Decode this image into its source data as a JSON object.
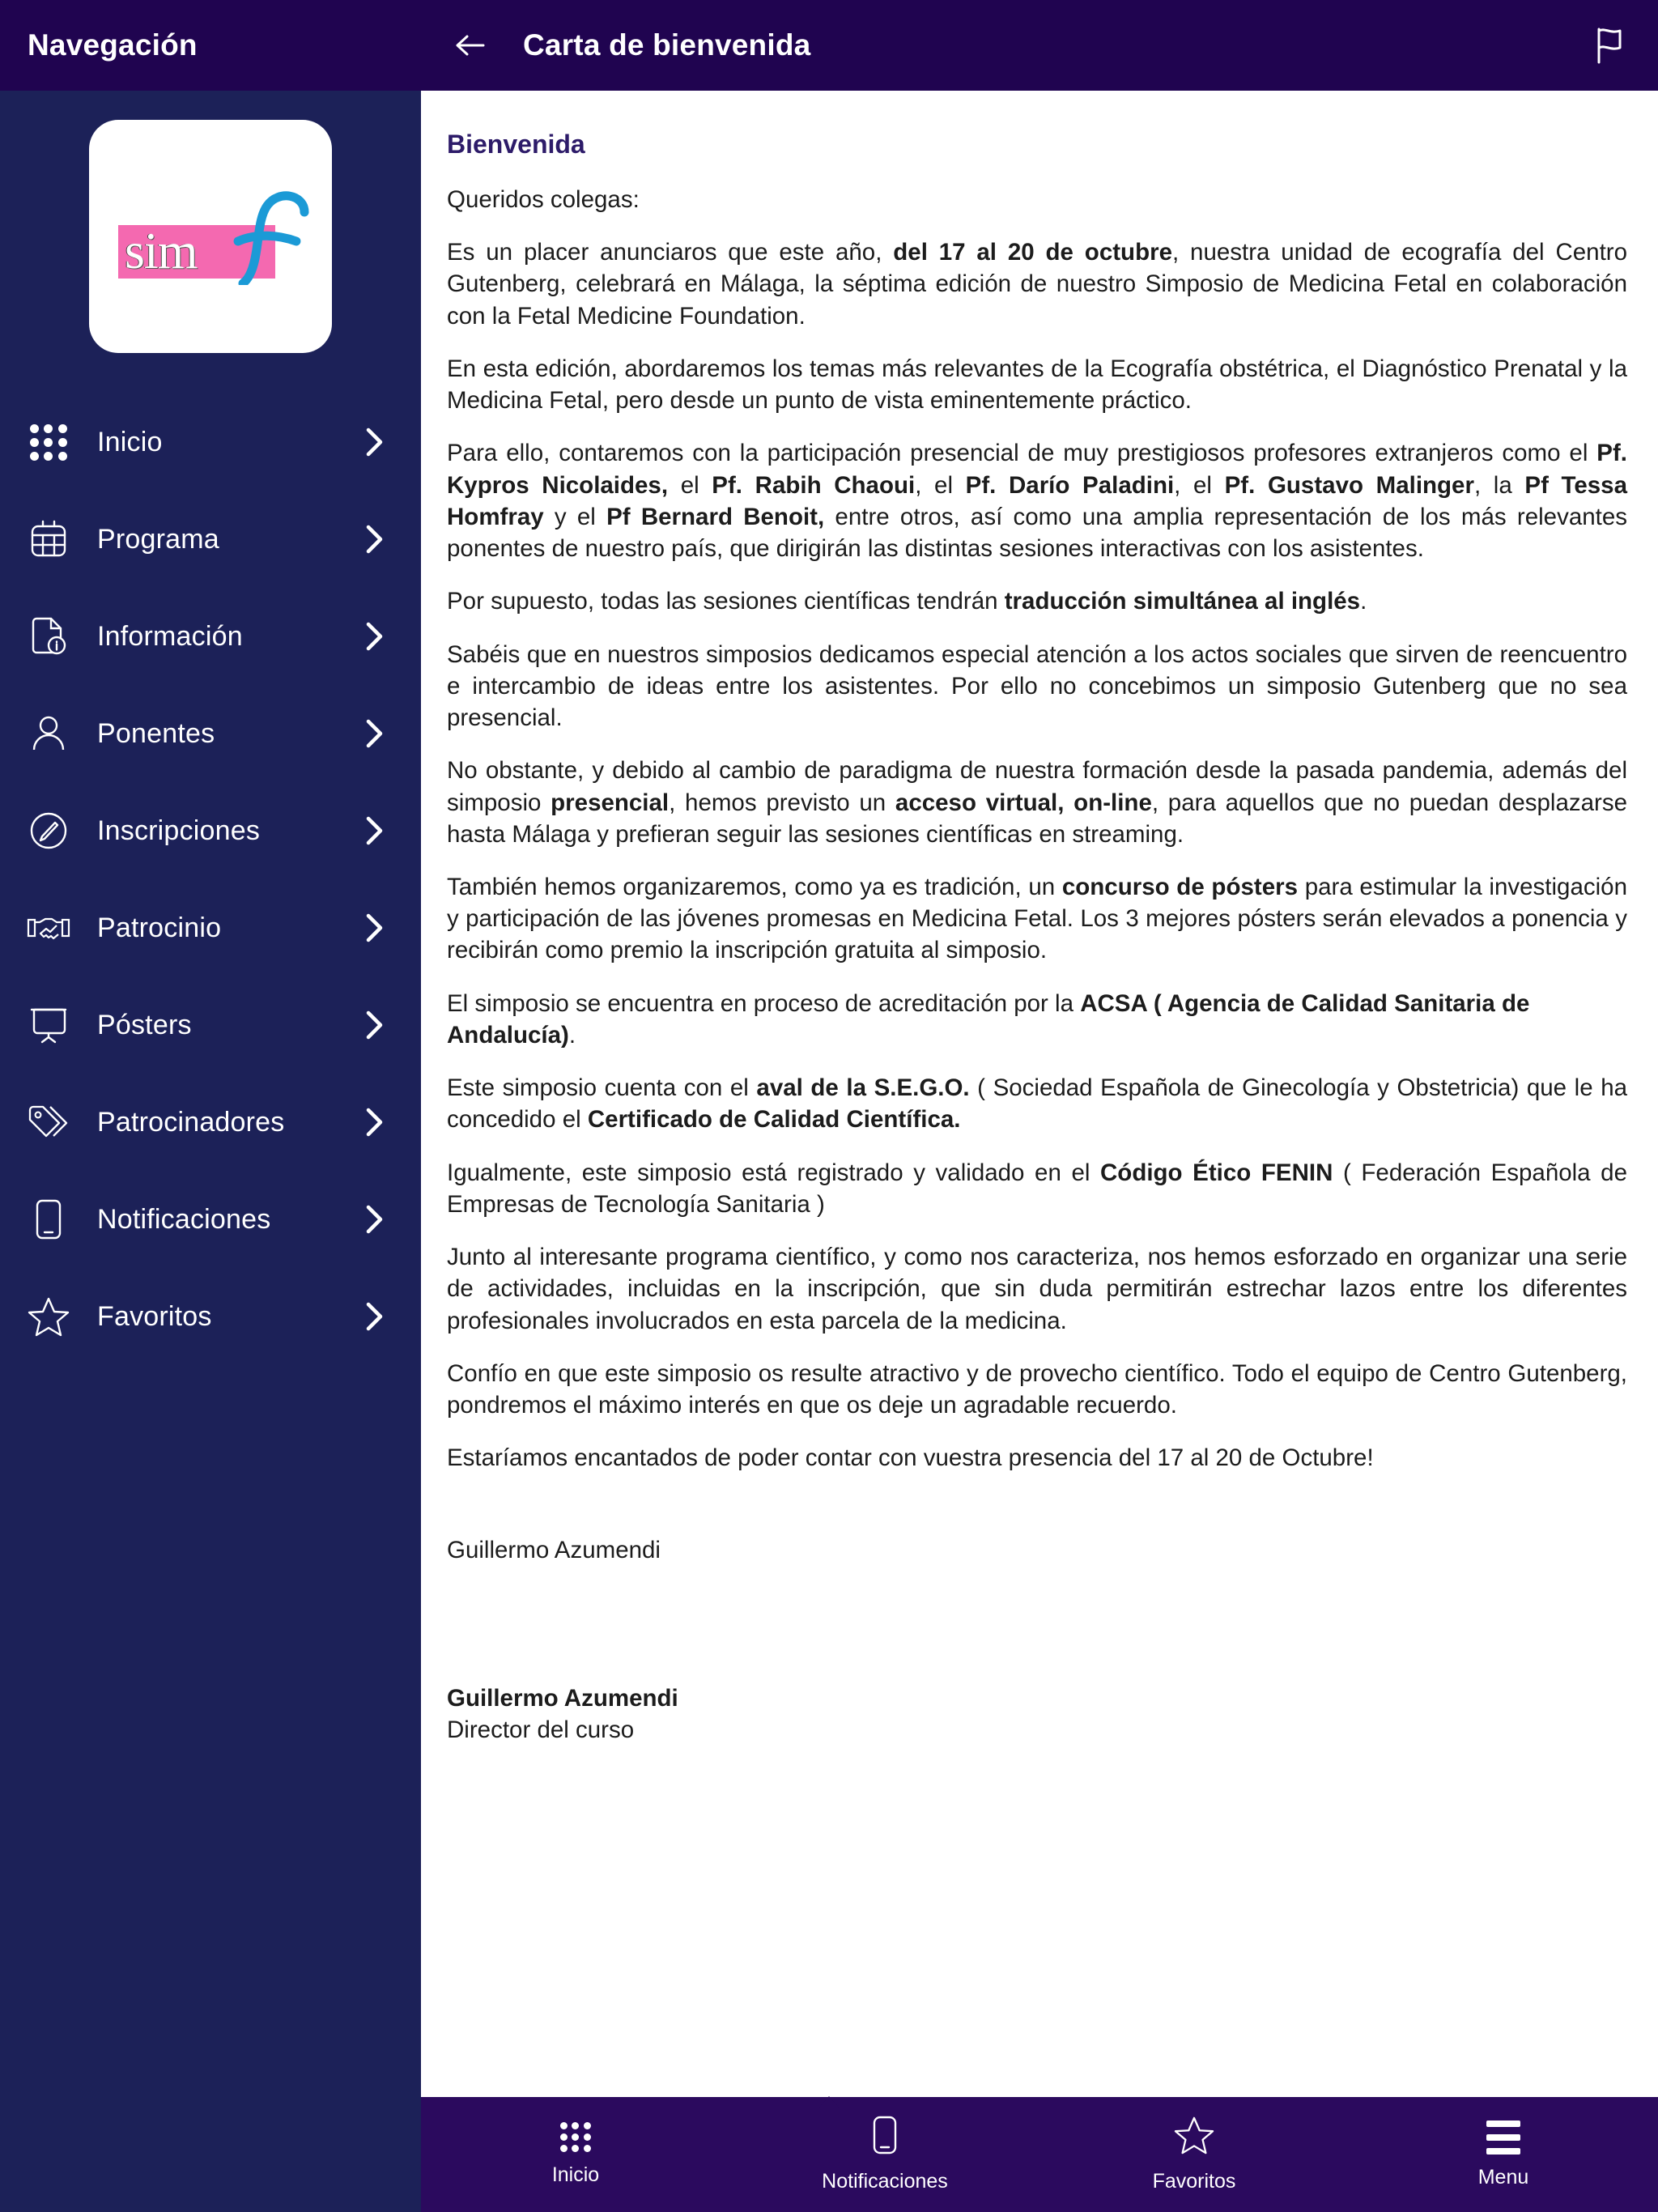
{
  "sidebar": {
    "title": "Navegación",
    "logo": {
      "text": "sim",
      "mark": "f-swoosh-mark",
      "pink": "#f469b0",
      "blue": "#1b9ad6"
    },
    "items": [
      {
        "label": "Inicio",
        "icon": "grid-dots-icon"
      },
      {
        "label": "Programa",
        "icon": "calendar-icon"
      },
      {
        "label": "Información",
        "icon": "document-info-icon"
      },
      {
        "label": "Ponentes",
        "icon": "person-icon"
      },
      {
        "label": "Inscripciones",
        "icon": "pencil-circle-icon"
      },
      {
        "label": "Patrocinio",
        "icon": "handshake-icon"
      },
      {
        "label": "Pósters",
        "icon": "presentation-board-icon"
      },
      {
        "label": "Patrocinadores",
        "icon": "tags-icon"
      },
      {
        "label": "Notificaciones",
        "icon": "phone-icon"
      },
      {
        "label": "Favoritos",
        "icon": "star-icon"
      }
    ]
  },
  "topbar": {
    "back_icon": "arrow-left-icon",
    "title": "Carta de bienvenida",
    "flag_icon": "flag-icon"
  },
  "document": {
    "title": "Bienvenida",
    "paragraphs": [
      "Queridos colegas:",
      "Es un placer anunciaros que este año, <b>del 17 al 20 de octubre</b>, nuestra unidad de ecografía del Centro Gutenberg, celebrará en Málaga, la séptima  edición de nuestro Simposio de Medicina Fetal en colaboración con la Fetal Medicine Foundation.",
      "En esta  edición, abordaremos los temas más relevantes de la Ecografía obstétrica, el Diagnóstico Prenatal y la Medicina Fetal, pero desde un punto de vista eminentemente práctico.",
      "Para ello, contaremos con la participación presencial de muy prestigiosos profesores extranjeros como el <b>Pf. Kypros Nicolaides,</b>  el <b>Pf. Rabih Chaoui</b>, el <b>Pf. Darío Paladini</b>, el <b>Pf. Gustavo Malinger</b>, la <b>Pf Tessa Homfray</b> y el <b>Pf Bernard Benoit,</b> entre otros, así como una amplia representación de los más relevantes ponentes de nuestro país, que dirigirán las distintas sesiones interactivas con los asistentes.",
      "Por supuesto, todas las sesiones científicas tendrán <b>traducción simultánea al inglés</b>.",
      "Sabéis que en nuestros simposios dedicamos especial atención a los actos sociales que sirven de reencuentro e intercambio de ideas entre los asistentes. Por ello no concebimos un simposio Gutenberg que no sea presencial.",
      "No obstante, y debido al cambio de paradigma de nuestra formación desde la pasada pandemia, además del simposio <b>presencial</b>, hemos previsto un <b>acceso virtual, on-line</b>, para aquellos que no puedan desplazarse hasta Málaga y prefieran seguir las sesiones científicas en streaming.",
      "También hemos organizaremos, como ya es tradición,  un <b>concurso de pósters</b> para estimular la investigación y participación de las jóvenes promesas en Medicina Fetal. Los 3 mejores pósters serán elevados a ponencia y recibirán como premio la inscripción gratuita al simposio.",
      "El simposio se encuentra en proceso de acreditación  por la  <b>ACSA ( Agencia de Calidad Sanitaria de Andalucía)</b>.",
      " Este simposio cuenta con el <b>aval de la S.E.G.O.</b> ( Sociedad Española de Ginecología y Obstetricia) que le ha concedido el <b>Certificado de Calidad Científica.</b>",
      " Igualmente, este simposio está registrado y validado en el <b>Código Ético FENIN</b> ( Federación Española de Empresas de Tecnología Sanitaria )",
      " Junto al interesante programa científico, y como nos caracteriza,  nos hemos esforzado en organizar una serie de actividades, incluidas en la inscripción, que sin duda permitirán estrechar lazos entre los diferentes profesionales involucrados en esta parcela de la medicina.",
      " Confío en que este simposio os resulte atractivo y de provecho científico. Todo el equipo de Centro Gutenberg, pondremos el máximo interés en que os deje un agradable recuerdo.",
      " Estaríamos encantados de poder contar con vuestra presencia del 17 al 20 de Octubre!"
    ],
    "signature_inline": " Guillermo Azumendi",
    "signature_name": "Guillermo Azumendi",
    "signature_role": "Director del curso"
  },
  "bottombar": {
    "items": [
      {
        "label": "Inicio",
        "icon": "grid-dots-icon"
      },
      {
        "label": "Notificaciones",
        "icon": "phone-icon"
      },
      {
        "label": "Favoritos",
        "icon": "star-icon"
      },
      {
        "label": "Menu",
        "icon": "hamburger-icon"
      }
    ]
  },
  "colors": {
    "header_purple": "#200450",
    "sidebar_navy": "#1c2158",
    "bottom_purple": "#2b0a5e",
    "doc_title": "#2d1b69"
  }
}
